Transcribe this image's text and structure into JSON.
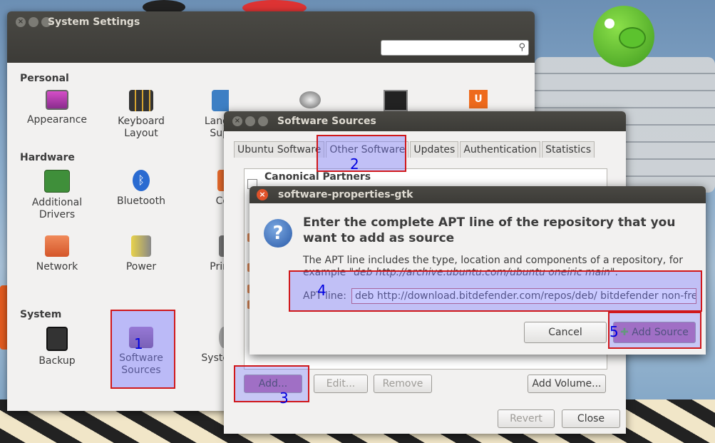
{
  "system_settings": {
    "title": "System Settings",
    "sections": {
      "personal": "Personal",
      "hardware": "Hardware",
      "system": "System"
    },
    "items": {
      "appearance": "Appearance",
      "keyboard_layout_1": "Keyboard",
      "keyboard_layout_2": "Layout",
      "language_partial_1": "Lang",
      "language_partial_2": "Sup",
      "additional_drivers_1": "Additional",
      "additional_drivers_2": "Drivers",
      "bluetooth": "Bluetooth",
      "color_partial": "Co",
      "network": "Network",
      "power": "Power",
      "printing_partial": "Prin",
      "backup": "Backup",
      "software_sources_1": "Software",
      "software_sources_2": "Sources",
      "system_partial": "Syste"
    }
  },
  "software_sources": {
    "title": "Software Sources",
    "tabs": [
      "Ubuntu Software",
      "Other Software",
      "Updates",
      "Authentication",
      "Statistics"
    ],
    "list_first": "Canonical Partners",
    "buttons": {
      "add": "Add...",
      "edit": "Edit...",
      "remove": "Remove",
      "add_volume": "Add Volume...",
      "revert": "Revert",
      "close": "Close"
    }
  },
  "dialog": {
    "title": "software-properties-gtk",
    "heading": "Enter the complete APT line of the repository that you want to add as source",
    "desc_1": "The APT line includes the type, location and components of a repository, for",
    "desc_2_prefix": "example ",
    "desc_2_example": "\"deb http://archive.ubuntu.com/ubuntu oneiric main\"",
    "desc_2_suffix": ".",
    "apt_label": "APT line:",
    "apt_value": "deb http://download.bitdefender.com/repos/deb/ bitdefender non-fre",
    "cancel": "Cancel",
    "add_source": "Add Source"
  },
  "annotations": [
    "1",
    "2",
    "3",
    "4",
    "5"
  ],
  "colors": {
    "highlight_border": "#d0181b",
    "highlight_fill": "#7878ff",
    "annotation_number": "#0000e0",
    "titlebar": "#3c3b37",
    "window_bg": "#f2f1f0"
  }
}
